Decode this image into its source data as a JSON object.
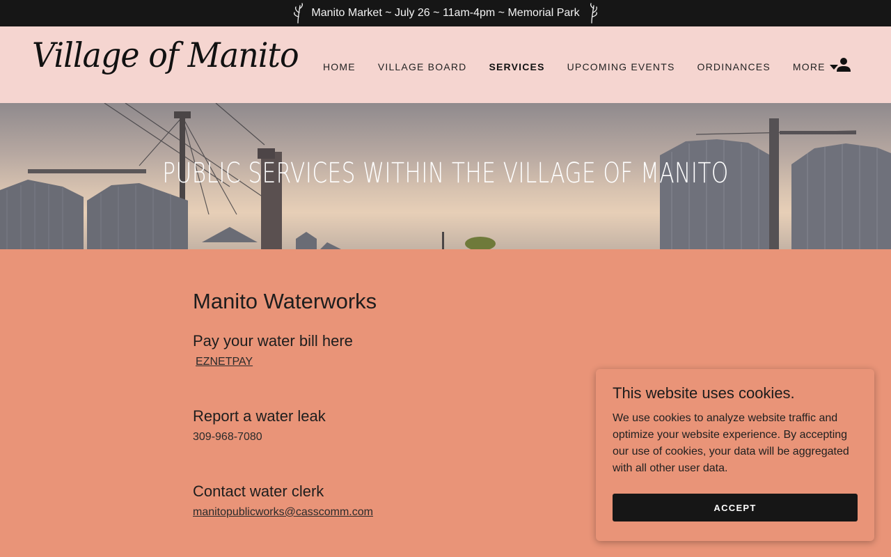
{
  "announcement": {
    "text": "Manito Market ~ July 26 ~ 11am-4pm ~ Memorial Park"
  },
  "header": {
    "logo": "Village of Manito",
    "nav": [
      {
        "label": "HOME",
        "active": false
      },
      {
        "label": "VILLAGE BOARD",
        "active": false
      },
      {
        "label": "SERVICES",
        "active": true
      },
      {
        "label": "UPCOMING EVENTS",
        "active": false
      },
      {
        "label": "ORDINANCES",
        "active": false
      },
      {
        "label": "MORE",
        "active": false
      }
    ],
    "account_icon": "user-icon"
  },
  "hero": {
    "title": "PUBLIC SERVICES WITHIN THE VILLAGE OF MANITO"
  },
  "main": {
    "title": "Manito Waterworks",
    "sections": [
      {
        "heading": "Pay your water bill here",
        "value": "EZNETPAY"
      },
      {
        "heading": "Report a water leak",
        "value": "309-968-7080"
      },
      {
        "heading": "Contact water clerk",
        "value": "manitopublicworks@casscomm.com"
      }
    ]
  },
  "cookie": {
    "title": "This website uses cookies.",
    "body": "We use cookies to analyze website traffic and optimize your website experience. By accepting our use of cookies, your data will be aggregated with all other user data.",
    "accept_label": "ACCEPT"
  },
  "colors": {
    "page_bg": "#e99478",
    "header_bg": "#f5d5d0",
    "dark": "#161616"
  }
}
